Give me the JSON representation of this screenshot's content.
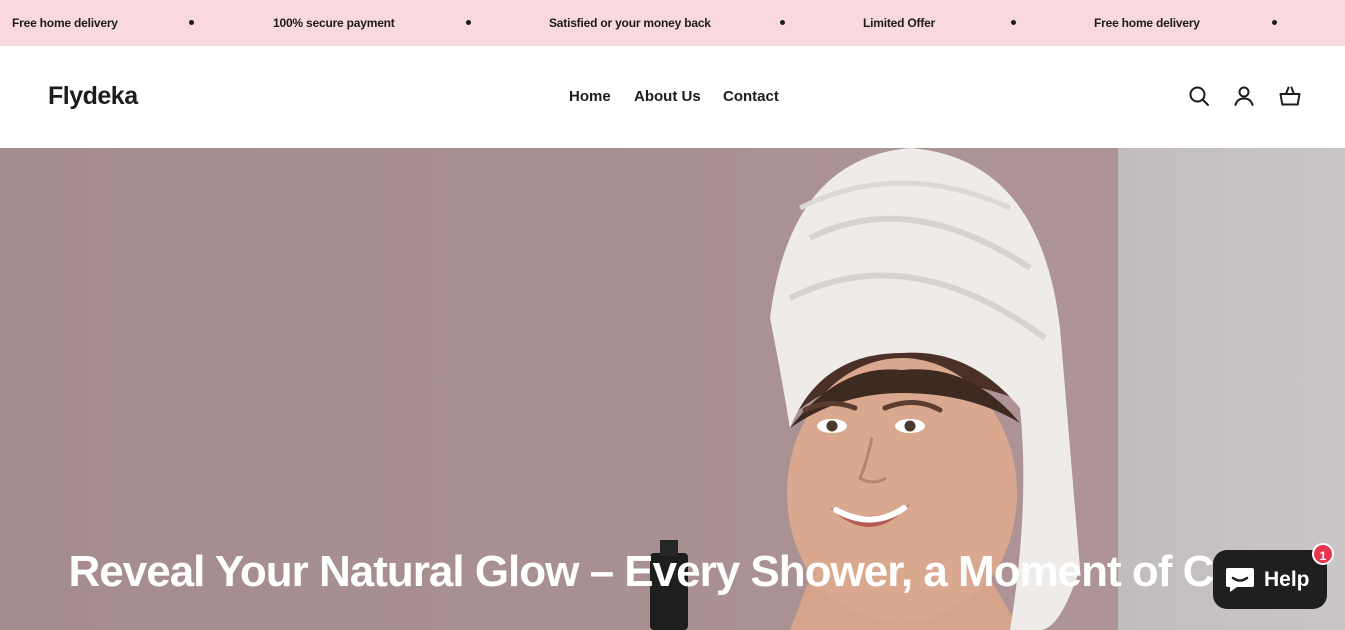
{
  "announcement": {
    "items": [
      "Free home delivery",
      "100% secure payment",
      "Satisfied or your money back",
      "Limited Offer",
      "Free home delivery"
    ]
  },
  "header": {
    "logo": "Flydeka",
    "nav": [
      "Home",
      "About Us",
      "Contact"
    ],
    "icons": [
      "search-icon",
      "account-icon",
      "cart-icon"
    ]
  },
  "hero": {
    "title": "Reveal Your Natural Glow – Every Shower, a Moment of Care"
  },
  "help": {
    "label": "Help",
    "badge": "1"
  },
  "colors": {
    "announcement_bg": "#f9d9de",
    "hero_bg": "#a48b8d",
    "help_bg": "#1f1f1f",
    "badge": "#e8344f"
  }
}
